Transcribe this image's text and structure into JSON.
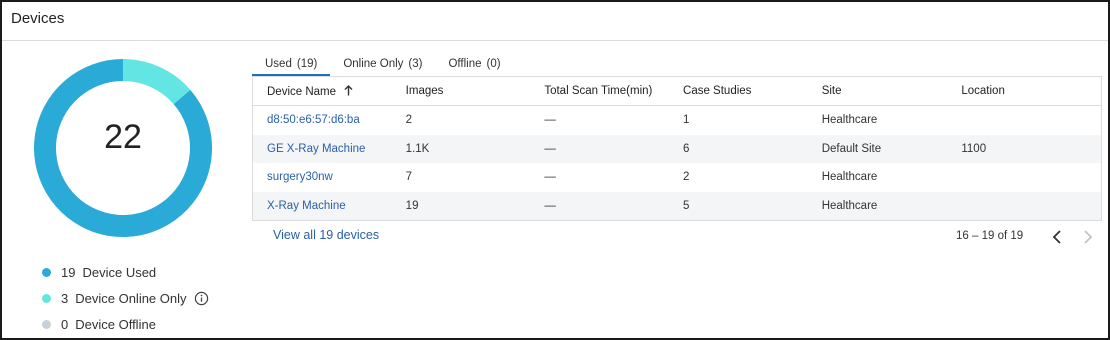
{
  "card": {
    "title": "Devices"
  },
  "summary": {
    "total": "22",
    "segments": [
      {
        "name": "Device Used",
        "value": 19,
        "color": "#2aaad6"
      },
      {
        "name": "Device Online Only",
        "value": 3,
        "color": "#63e6e3"
      },
      {
        "name": "Device Offline",
        "value": 0,
        "color": "#c8d0db"
      }
    ]
  },
  "legend": {
    "used": {
      "count": "19",
      "label": "Device Used",
      "color": "#2aaad6"
    },
    "online": {
      "count": "3",
      "label": "Device Online Only",
      "color": "#63e6e3"
    },
    "offline": {
      "count": "0",
      "label": "Device Offline",
      "color": "#c8d0db"
    }
  },
  "tabs": [
    {
      "label": "Used",
      "count": "(19)",
      "active": true
    },
    {
      "label": "Online Only",
      "count": "(3)",
      "active": false
    },
    {
      "label": "Offline",
      "count": "(0)",
      "active": false
    }
  ],
  "table": {
    "headers": [
      "Device Name",
      "Images",
      "Total Scan Time(min)",
      "Case Studies",
      "Site",
      "Location"
    ],
    "sort_column": "Device Name",
    "sort_direction": "ascending",
    "rows": [
      [
        "d8:50:e6:57:d6:ba",
        "2",
        "—",
        "1",
        "Healthcare",
        ""
      ],
      [
        "GE X-Ray Machine",
        "1.1K",
        "—",
        "6",
        "Default Site",
        "1100"
      ],
      [
        "surgery30nw",
        "7",
        "—",
        "2",
        "Healthcare",
        ""
      ],
      [
        "X-Ray Machine",
        "19",
        "—",
        "5",
        "Healthcare",
        ""
      ]
    ]
  },
  "footer": {
    "view_all": "View all 19 devices",
    "range": "16 – 19 of 19"
  },
  "icons": {
    "info": "info-circle-icon",
    "sort": "arrow-up-icon",
    "prev": "chevron-left-icon",
    "next": "chevron-right-icon"
  }
}
